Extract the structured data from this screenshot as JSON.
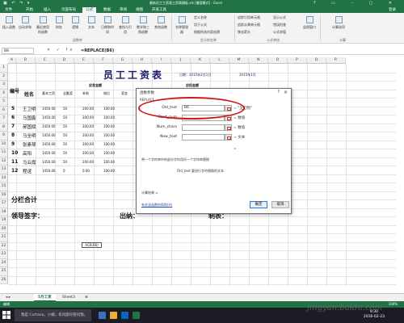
{
  "window": {
    "title": "最新员工工资表工资表模板.xls  [兼容模式] - Excel",
    "login": "登录"
  },
  "ribbon_tabs": [
    "文件",
    "开始",
    "插入",
    "页面布局",
    "公式",
    "数据",
    "审阅",
    "视图",
    "开发工具"
  ],
  "ribbon": {
    "buttons": [
      "插入函数",
      "自动求和",
      "最近使用的函数",
      "财务",
      "逻辑",
      "文本",
      "日期和时间",
      "查找与引用",
      "数学和三角函数",
      "其他函数",
      "名称管理器"
    ],
    "small": [
      "定义名称",
      "用于公式",
      "根据所选内容创建",
      "追踪引用单元格",
      "追踪从属单元格",
      "移去箭头",
      "显示公式",
      "错误检查",
      "公式求值",
      "监视窗口",
      "计算选项"
    ],
    "groups": [
      "函数库",
      "定义的名称",
      "公式审核",
      "计算"
    ]
  },
  "formula_bar": {
    "name_box": "B6",
    "formula": "=REPLACE(B6)"
  },
  "columns": [
    "A",
    "B",
    "C",
    "D",
    "E",
    "F",
    "G",
    "H",
    "I",
    "J",
    "K",
    "L",
    "M",
    "N",
    "O",
    "P",
    "Q",
    "R"
  ],
  "rows": [
    "1",
    "2",
    "3",
    "4",
    "5",
    "6",
    "7",
    "8",
    "9",
    "10",
    "11",
    "12",
    "13",
    "14",
    "15",
    "16",
    "17",
    "18",
    "19",
    "20",
    "21",
    "22",
    "23",
    "24",
    "25",
    "26"
  ],
  "sheet": {
    "title": "员工工资表",
    "subtitle_left": "日期：2015年2月1日",
    "subtitle_right": "2015年1月",
    "header_no": "编号",
    "header_name": "姓名",
    "header_group": "应发金额",
    "header_group2": "应扣金额",
    "subheaders": [
      "基本工资",
      "全勤奖",
      "补助",
      "岗位",
      "奖金"
    ],
    "names": [
      "王卫明",
      "马国鑫",
      "郝国斌",
      "马全明",
      "张素琴",
      "高阳",
      "马云霞",
      "程谊"
    ],
    "salary": [
      [
        "1450.00",
        "50",
        "200.00",
        "100.00",
        ""
      ],
      [
        "1450.00",
        "50",
        "200.00",
        "100.00",
        ""
      ],
      [
        "1450.00",
        "50",
        "200.00",
        "100.00",
        ""
      ],
      [
        "1450.00",
        "50",
        "200.00",
        "100.00",
        ""
      ],
      [
        "1450.00",
        "50",
        "200.00",
        "100.00",
        ""
      ],
      [
        "1450.00",
        "50",
        "200.00",
        "100.00",
        ""
      ],
      [
        "1450.00",
        "50",
        "200.00",
        "100.00",
        ""
      ],
      [
        "1450.00",
        "0",
        "0.00",
        "100.00",
        ""
      ]
    ],
    "total_label": "分栏合计",
    "sign_leader": "领导签字：",
    "sign_cashier": "出纳：",
    "sign_accountant": "制表：",
    "floating_cell": "ACE(B6)"
  },
  "dialog": {
    "title": "函数参数",
    "help": "?",
    "close": "×",
    "function_name": "REPLACE",
    "args": [
      {
        "label": "Old_text",
        "value": "B6",
        "result": "= \"王卫明\""
      },
      {
        "label": "Start_num",
        "value": "",
        "result": "= 数值"
      },
      {
        "label": "Num_chars",
        "value": "",
        "result": "= 数值"
      },
      {
        "label": "New_text",
        "value": "",
        "result": "= 文本"
      }
    ],
    "equals": "=",
    "description": "将一个字符串中的部分字符用另一个字符串替换",
    "arg_description": "Old_text   要进行字符替换的文本",
    "result_label": "计算结果 =",
    "help_link": "有关该函数的帮助(H)",
    "ok": "确定",
    "cancel": "取消"
  },
  "sheet_tabs": [
    "5月工资",
    "Sheet3"
  ],
  "status": {
    "ready": "编辑",
    "zoom": "100%"
  },
  "taskbar": {
    "search": "我是 Cortana，小娜。有问题尽管问我。",
    "time": "9:30",
    "date": "2016-02-23"
  },
  "watermark": "jingyan.baidu.com",
  "colors": {
    "excel_green": "#217346",
    "oval_red": "#d01818",
    "title_blue": "#1a1a6a"
  }
}
